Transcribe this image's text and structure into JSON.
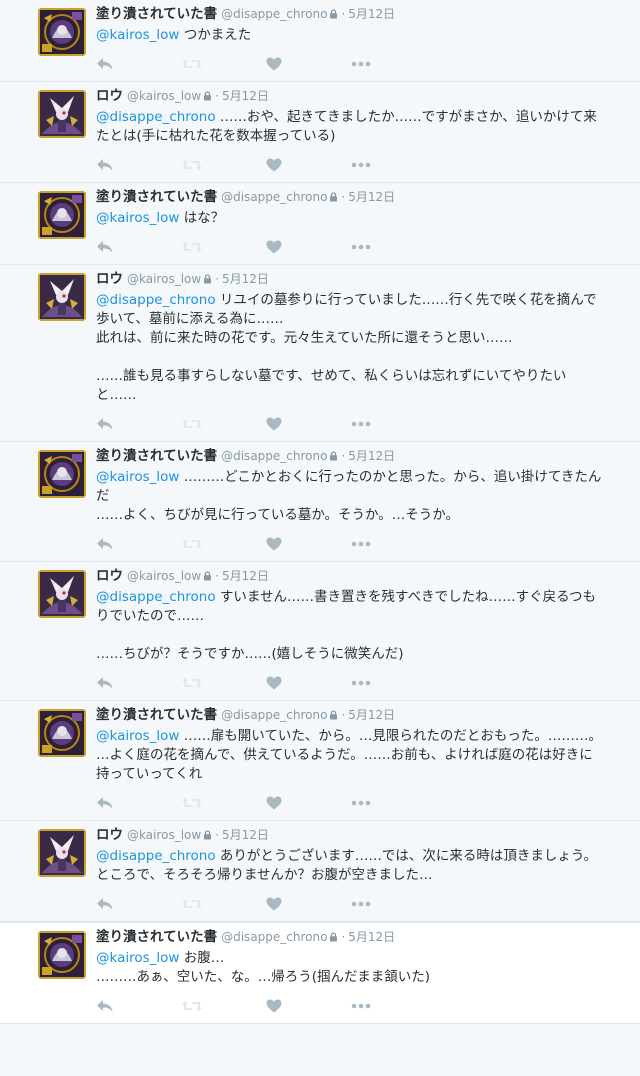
{
  "accounts": {
    "book": {
      "name": "塗り潰されていた書",
      "handle": "@disappe_chrono",
      "avatar_icon": "book-character-avatar-icon"
    },
    "low": {
      "name": "ロウ",
      "handle": "@kairos_low",
      "avatar_icon": "low-character-avatar-icon"
    }
  },
  "colors": {
    "link": "#1b95e0",
    "muted": "#8899a6",
    "border": "#e1e8ed",
    "background": "#f5f8fa"
  },
  "icons": {
    "reply": "reply-icon",
    "retweet": "retweet-icon",
    "like": "heart-icon",
    "more": "more-icon",
    "lock": "lock-icon"
  },
  "tweets": [
    {
      "account": "book",
      "name": "塗り潰されていた書",
      "handle": "@disappe_chrono",
      "dot": "·",
      "date": "5月12日",
      "mention": "@kairos_low",
      "text": " つかまえた"
    },
    {
      "account": "low",
      "name": "ロウ",
      "handle": "@kairos_low",
      "dot": "·",
      "date": "5月12日",
      "mention": "@disappe_chrono",
      "text": " ……おや、起きてきましたか……ですがまさか、追いかけて来たとは(手に枯れた花を数本握っている)"
    },
    {
      "account": "book",
      "name": "塗り潰されていた書",
      "handle": "@disappe_chrono",
      "dot": "·",
      "date": "5月12日",
      "mention": "@kairos_low",
      "text": " はな？"
    },
    {
      "account": "low",
      "name": "ロウ",
      "handle": "@kairos_low",
      "dot": "·",
      "date": "5月12日",
      "mention": "@disappe_chrono",
      "text": " リユイの墓参りに行っていました……行く先で咲く花を摘んで歩いて、墓前に添える為に……\n此れは、前に来た時の花です。元々生えていた所に還そうと思い……\n\n……誰も見る事すらしない墓です、せめて、私くらいは忘れずにいてやりたいと……"
    },
    {
      "account": "book",
      "name": "塗り潰されていた書",
      "handle": "@disappe_chrono",
      "dot": "·",
      "date": "5月12日",
      "mention": "@kairos_low",
      "text": " ………どこかとおくに行ったのかと思った。から、追い掛けてきたんだ\n……よく、ちびが見に行っている墓か。そうか。…そうか。"
    },
    {
      "account": "low",
      "name": "ロウ",
      "handle": "@kairos_low",
      "dot": "·",
      "date": "5月12日",
      "mention": "@disappe_chrono",
      "text": " すいません……書き置きを残すべきでしたね……すぐ戻るつもりでいたので……\n\n……ちびが？そうですか……(嬉しそうに微笑んだ)"
    },
    {
      "account": "book",
      "name": "塗り潰されていた書",
      "handle": "@disappe_chrono",
      "dot": "·",
      "date": "5月12日",
      "mention": "@kairos_low",
      "text": " ……扉も開いていた、から。…見限られたのだとおもった。………。\n…よく庭の花を摘んで、供えているようだ。……お前も、よければ庭の花は好きに持っていってくれ"
    },
    {
      "account": "low",
      "name": "ロウ",
      "handle": "@kairos_low",
      "dot": "·",
      "date": "5月12日",
      "mention": "@disappe_chrono",
      "text": " ありがとうございます……では、次に来る時は頂きましょう。ところで、そろそろ帰りませんか？お腹が空きました…"
    },
    {
      "account": "book",
      "name": "塗り潰されていた書",
      "handle": "@disappe_chrono",
      "dot": "·",
      "date": "5月12日",
      "mention": "@kairos_low",
      "text": " お腹…\n………あぁ、空いた、な。…帰ろう(掴んだまま頷いた)"
    }
  ]
}
